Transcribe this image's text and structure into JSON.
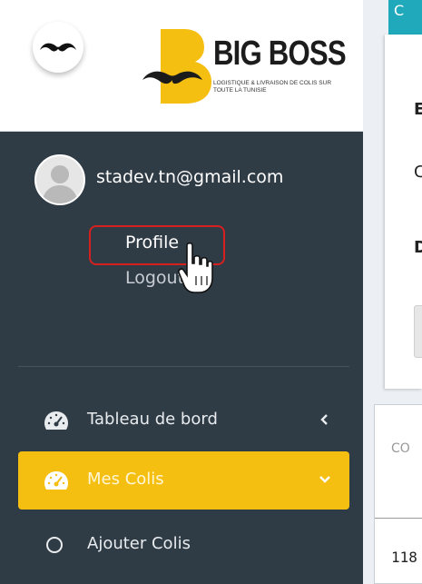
{
  "brand": {
    "name": "BIG BOSS",
    "tagline": "LOGISTIQUE & LIVRAISON DE COLIS SUR TOUTE LA TUNISIE",
    "accent_color": "#f5bf12"
  },
  "user": {
    "email": "stadev.tn@gmail.com",
    "profile_label": "Profile",
    "logout_label": "Logout"
  },
  "menu": {
    "items": [
      {
        "label": "Tableau de bord",
        "icon": "dashboard-icon",
        "chevron": "chevron-left-icon"
      },
      {
        "label": "Mes Colis",
        "icon": "dashboard-icon",
        "chevron": "chevron-down-icon",
        "active": true
      },
      {
        "label": "Ajouter Colis",
        "icon": "circle-icon"
      }
    ]
  },
  "content": {
    "header_fragment": "C",
    "card_rows": [
      "E",
      "C",
      "D"
    ],
    "table_header": "CO",
    "table_cell": "118"
  }
}
